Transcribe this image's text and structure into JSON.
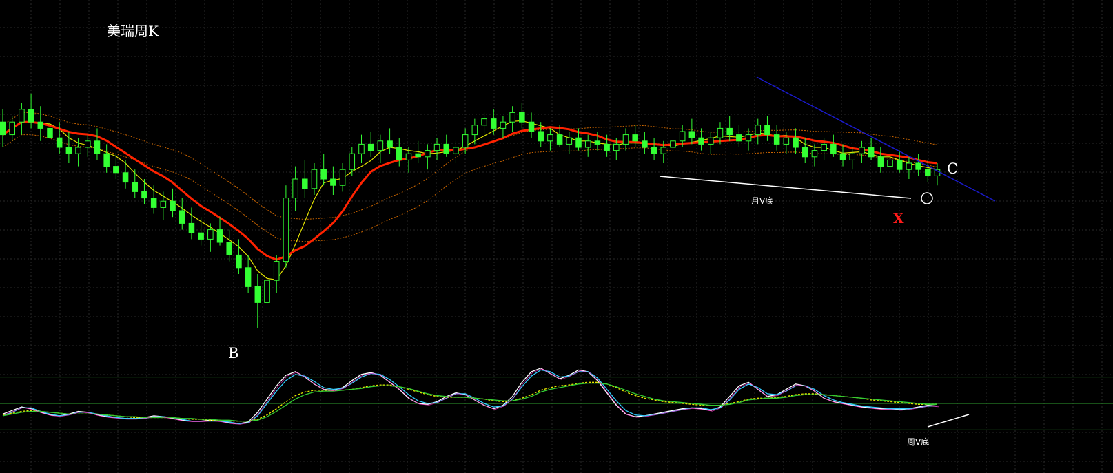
{
  "title": "美瑞周K",
  "annotations": {
    "point_b": "B",
    "point_c": "C",
    "mark_x": "X",
    "monthly_v_bottom": "月V底",
    "weekly_v_bottom": "周V底"
  },
  "colors": {
    "background": "#000000",
    "grid": "#2a2a2a",
    "candle_up": "#33ff33",
    "candle_down": "#33ff33",
    "ma_red": "#ff2200",
    "ma_yellow": "#e6e600",
    "ma_dotted_orange": "#cc6600",
    "trendline_blue": "#1a1acc",
    "support_white": "#ffffff",
    "price_level_green": "#2f9f2f",
    "mark_x_red": "#ff1a1a",
    "osc_white": "#ffffff",
    "osc_cyan": "#33ccff",
    "osc_magenta": "#ff33cc",
    "osc_yellow": "#e6e600",
    "osc_green": "#33cc33",
    "osc_level": "#2f9f2f"
  },
  "chart_data": [
    {
      "type": "candlestick",
      "panel": "price",
      "title": "美瑞周K",
      "grid": true,
      "ylim": [
        0,
        100
      ],
      "candles": [
        {
          "o": 68,
          "h": 72,
          "l": 60,
          "c": 64
        },
        {
          "o": 64,
          "h": 70,
          "l": 62,
          "c": 68
        },
        {
          "o": 68,
          "h": 74,
          "l": 64,
          "c": 72
        },
        {
          "o": 72,
          "h": 77,
          "l": 66,
          "c": 68
        },
        {
          "o": 68,
          "h": 73,
          "l": 62,
          "c": 66
        },
        {
          "o": 66,
          "h": 70,
          "l": 60,
          "c": 63
        },
        {
          "o": 63,
          "h": 68,
          "l": 58,
          "c": 60
        },
        {
          "o": 60,
          "h": 65,
          "l": 55,
          "c": 58
        },
        {
          "o": 58,
          "h": 63,
          "l": 54,
          "c": 60
        },
        {
          "o": 60,
          "h": 64,
          "l": 57,
          "c": 62
        },
        {
          "o": 62,
          "h": 66,
          "l": 56,
          "c": 58
        },
        {
          "o": 58,
          "h": 61,
          "l": 52,
          "c": 54
        },
        {
          "o": 54,
          "h": 58,
          "l": 50,
          "c": 52
        },
        {
          "o": 52,
          "h": 56,
          "l": 47,
          "c": 49
        },
        {
          "o": 49,
          "h": 53,
          "l": 44,
          "c": 46
        },
        {
          "o": 46,
          "h": 50,
          "l": 42,
          "c": 44
        },
        {
          "o": 44,
          "h": 48,
          "l": 39,
          "c": 41
        },
        {
          "o": 41,
          "h": 46,
          "l": 37,
          "c": 43
        },
        {
          "o": 43,
          "h": 47,
          "l": 38,
          "c": 40
        },
        {
          "o": 40,
          "h": 44,
          "l": 34,
          "c": 36
        },
        {
          "o": 36,
          "h": 41,
          "l": 31,
          "c": 33
        },
        {
          "o": 33,
          "h": 38,
          "l": 29,
          "c": 31
        },
        {
          "o": 31,
          "h": 36,
          "l": 27,
          "c": 34
        },
        {
          "o": 34,
          "h": 38,
          "l": 29,
          "c": 30
        },
        {
          "o": 30,
          "h": 34,
          "l": 24,
          "c": 26
        },
        {
          "o": 26,
          "h": 31,
          "l": 20,
          "c": 22
        },
        {
          "o": 22,
          "h": 26,
          "l": 14,
          "c": 16
        },
        {
          "o": 16,
          "h": 20,
          "l": 3,
          "c": 11
        },
        {
          "o": 11,
          "h": 20,
          "l": 9,
          "c": 18
        },
        {
          "o": 18,
          "h": 26,
          "l": 14,
          "c": 24
        },
        {
          "o": 24,
          "h": 48,
          "l": 22,
          "c": 44
        },
        {
          "o": 44,
          "h": 54,
          "l": 40,
          "c": 50
        },
        {
          "o": 50,
          "h": 56,
          "l": 44,
          "c": 47
        },
        {
          "o": 47,
          "h": 55,
          "l": 45,
          "c": 53
        },
        {
          "o": 53,
          "h": 58,
          "l": 48,
          "c": 50
        },
        {
          "o": 50,
          "h": 54,
          "l": 45,
          "c": 48
        },
        {
          "o": 48,
          "h": 55,
          "l": 46,
          "c": 53
        },
        {
          "o": 53,
          "h": 60,
          "l": 51,
          "c": 58
        },
        {
          "o": 58,
          "h": 64,
          "l": 55,
          "c": 61
        },
        {
          "o": 61,
          "h": 65,
          "l": 57,
          "c": 59
        },
        {
          "o": 59,
          "h": 64,
          "l": 55,
          "c": 62
        },
        {
          "o": 62,
          "h": 66,
          "l": 58,
          "c": 60
        },
        {
          "o": 60,
          "h": 63,
          "l": 54,
          "c": 56
        },
        {
          "o": 56,
          "h": 60,
          "l": 52,
          "c": 58
        },
        {
          "o": 58,
          "h": 62,
          "l": 55,
          "c": 57
        },
        {
          "o": 57,
          "h": 61,
          "l": 53,
          "c": 59
        },
        {
          "o": 59,
          "h": 63,
          "l": 56,
          "c": 61
        },
        {
          "o": 61,
          "h": 64,
          "l": 57,
          "c": 58
        },
        {
          "o": 58,
          "h": 62,
          "l": 55,
          "c": 60
        },
        {
          "o": 60,
          "h": 66,
          "l": 58,
          "c": 64
        },
        {
          "o": 64,
          "h": 69,
          "l": 61,
          "c": 67
        },
        {
          "o": 67,
          "h": 71,
          "l": 63,
          "c": 69
        },
        {
          "o": 69,
          "h": 72,
          "l": 64,
          "c": 66
        },
        {
          "o": 66,
          "h": 70,
          "l": 63,
          "c": 68
        },
        {
          "o": 68,
          "h": 73,
          "l": 65,
          "c": 71
        },
        {
          "o": 71,
          "h": 74,
          "l": 66,
          "c": 68
        },
        {
          "o": 68,
          "h": 71,
          "l": 63,
          "c": 65
        },
        {
          "o": 65,
          "h": 68,
          "l": 60,
          "c": 62
        },
        {
          "o": 62,
          "h": 66,
          "l": 59,
          "c": 64
        },
        {
          "o": 64,
          "h": 67,
          "l": 60,
          "c": 61
        },
        {
          "o": 61,
          "h": 65,
          "l": 58,
          "c": 63
        },
        {
          "o": 63,
          "h": 66,
          "l": 59,
          "c": 60
        },
        {
          "o": 60,
          "h": 64,
          "l": 57,
          "c": 62
        },
        {
          "o": 62,
          "h": 65,
          "l": 59,
          "c": 61
        },
        {
          "o": 61,
          "h": 64,
          "l": 57,
          "c": 59
        },
        {
          "o": 59,
          "h": 63,
          "l": 56,
          "c": 61
        },
        {
          "o": 61,
          "h": 66,
          "l": 59,
          "c": 64
        },
        {
          "o": 64,
          "h": 67,
          "l": 60,
          "c": 62
        },
        {
          "o": 62,
          "h": 65,
          "l": 58,
          "c": 60
        },
        {
          "o": 60,
          "h": 63,
          "l": 56,
          "c": 58
        },
        {
          "o": 58,
          "h": 62,
          "l": 55,
          "c": 60
        },
        {
          "o": 60,
          "h": 64,
          "l": 57,
          "c": 62
        },
        {
          "o": 62,
          "h": 67,
          "l": 60,
          "c": 65
        },
        {
          "o": 65,
          "h": 69,
          "l": 61,
          "c": 63
        },
        {
          "o": 63,
          "h": 66,
          "l": 59,
          "c": 61
        },
        {
          "o": 61,
          "h": 65,
          "l": 58,
          "c": 63
        },
        {
          "o": 63,
          "h": 68,
          "l": 61,
          "c": 66
        },
        {
          "o": 66,
          "h": 70,
          "l": 62,
          "c": 64
        },
        {
          "o": 64,
          "h": 67,
          "l": 60,
          "c": 62
        },
        {
          "o": 62,
          "h": 66,
          "l": 59,
          "c": 64
        },
        {
          "o": 64,
          "h": 69,
          "l": 61,
          "c": 67
        },
        {
          "o": 67,
          "h": 70,
          "l": 62,
          "c": 64
        },
        {
          "o": 64,
          "h": 67,
          "l": 59,
          "c": 61
        },
        {
          "o": 61,
          "h": 65,
          "l": 58,
          "c": 63
        },
        {
          "o": 63,
          "h": 66,
          "l": 58,
          "c": 60
        },
        {
          "o": 60,
          "h": 63,
          "l": 55,
          "c": 57
        },
        {
          "o": 57,
          "h": 61,
          "l": 54,
          "c": 59
        },
        {
          "o": 59,
          "h": 63,
          "l": 56,
          "c": 61
        },
        {
          "o": 61,
          "h": 64,
          "l": 57,
          "c": 58
        },
        {
          "o": 58,
          "h": 61,
          "l": 54,
          "c": 56
        },
        {
          "o": 56,
          "h": 60,
          "l": 53,
          "c": 58
        },
        {
          "o": 58,
          "h": 62,
          "l": 55,
          "c": 60
        },
        {
          "o": 60,
          "h": 63,
          "l": 56,
          "c": 57
        },
        {
          "o": 57,
          "h": 60,
          "l": 52,
          "c": 54
        },
        {
          "o": 54,
          "h": 58,
          "l": 51,
          "c": 56
        },
        {
          "o": 56,
          "h": 59,
          "l": 52,
          "c": 53
        },
        {
          "o": 53,
          "h": 57,
          "l": 50,
          "c": 55
        },
        {
          "o": 55,
          "h": 58,
          "l": 51,
          "c": 53
        },
        {
          "o": 53,
          "h": 56,
          "l": 49,
          "c": 51
        },
        {
          "o": 51,
          "h": 55,
          "l": 48,
          "c": 53
        }
      ]
    },
    {
      "type": "line",
      "panel": "oscillator",
      "ylim": [
        0,
        100
      ],
      "levels": [
        80,
        50,
        20
      ],
      "series": [
        {
          "values": [
            38,
            42,
            46,
            44,
            40,
            37,
            36,
            38,
            41,
            40,
            37,
            35,
            34,
            33,
            33,
            34,
            36,
            35,
            33,
            31,
            30,
            30,
            31,
            30,
            28,
            27,
            29,
            40,
            55,
            70,
            82,
            86,
            80,
            72,
            66,
            65,
            68,
            76,
            83,
            85,
            82,
            74,
            66,
            56,
            50,
            49,
            52,
            58,
            62,
            60,
            54,
            48,
            44,
            48,
            58,
            74,
            86,
            90,
            84,
            78,
            82,
            88,
            86,
            76,
            62,
            48,
            38,
            35,
            36,
            38,
            40,
            42,
            44,
            45,
            44,
            42,
            46,
            58,
            70,
            74,
            66,
            58,
            60,
            66,
            72,
            70,
            64,
            56,
            52,
            50,
            48,
            46,
            45,
            44,
            44,
            43,
            44,
            46,
            48,
            47
          ]
        },
        {
          "values": [
            36,
            40,
            45,
            45,
            41,
            38,
            36,
            37,
            40,
            40,
            38,
            36,
            34,
            33,
            33,
            33,
            35,
            35,
            34,
            32,
            30,
            30,
            30,
            30,
            29,
            27,
            28,
            36,
            50,
            64,
            76,
            83,
            81,
            75,
            68,
            66,
            67,
            73,
            80,
            84,
            83,
            77,
            69,
            60,
            53,
            50,
            51,
            56,
            61,
            61,
            56,
            50,
            46,
            47,
            55,
            69,
            81,
            88,
            86,
            80,
            81,
            86,
            86,
            79,
            66,
            53,
            42,
            37,
            36,
            37,
            39,
            41,
            43,
            45,
            45,
            43,
            45,
            54,
            66,
            72,
            68,
            61,
            60,
            64,
            70,
            70,
            66,
            59,
            54,
            51,
            49,
            47,
            46,
            45,
            44,
            44,
            44,
            45,
            47,
            47
          ]
        },
        {
          "values": [
            37,
            39,
            41,
            42,
            41,
            40,
            39,
            38,
            38,
            38,
            38,
            37,
            36,
            35,
            34,
            34,
            34,
            34,
            34,
            33,
            32,
            32,
            31,
            31,
            30,
            30,
            30,
            32,
            37,
            44,
            52,
            59,
            63,
            65,
            65,
            65,
            65,
            66,
            68,
            70,
            71,
            71,
            69,
            66,
            63,
            60,
            58,
            57,
            57,
            57,
            56,
            55,
            53,
            52,
            53,
            56,
            60,
            65,
            68,
            70,
            71,
            73,
            74,
            74,
            72,
            68,
            63,
            59,
            56,
            54,
            52,
            51,
            50,
            49,
            48,
            48,
            48,
            50,
            52,
            55,
            56,
            56,
            57,
            58,
            60,
            61,
            61,
            60,
            59,
            58,
            57,
            56,
            54,
            53,
            52,
            51,
            50,
            49,
            49,
            49
          ]
        },
        {
          "values": [
            36,
            38,
            40,
            41,
            41,
            40,
            39,
            38,
            38,
            38,
            38,
            37,
            36,
            35,
            35,
            34,
            34,
            34,
            34,
            33,
            33,
            32,
            32,
            31,
            31,
            30,
            30,
            31,
            35,
            41,
            48,
            55,
            60,
            63,
            64,
            64,
            65,
            66,
            67,
            69,
            70,
            70,
            69,
            67,
            64,
            61,
            59,
            58,
            57,
            57,
            56,
            55,
            54,
            53,
            53,
            55,
            58,
            63,
            66,
            68,
            70,
            72,
            73,
            73,
            72,
            69,
            65,
            61,
            58,
            55,
            53,
            52,
            51,
            50,
            49,
            48,
            48,
            49,
            51,
            54,
            55,
            56,
            56,
            57,
            59,
            60,
            60,
            60,
            59,
            58,
            57,
            56,
            55,
            54,
            53,
            52,
            51,
            50,
            49,
            49
          ]
        }
      ]
    }
  ]
}
